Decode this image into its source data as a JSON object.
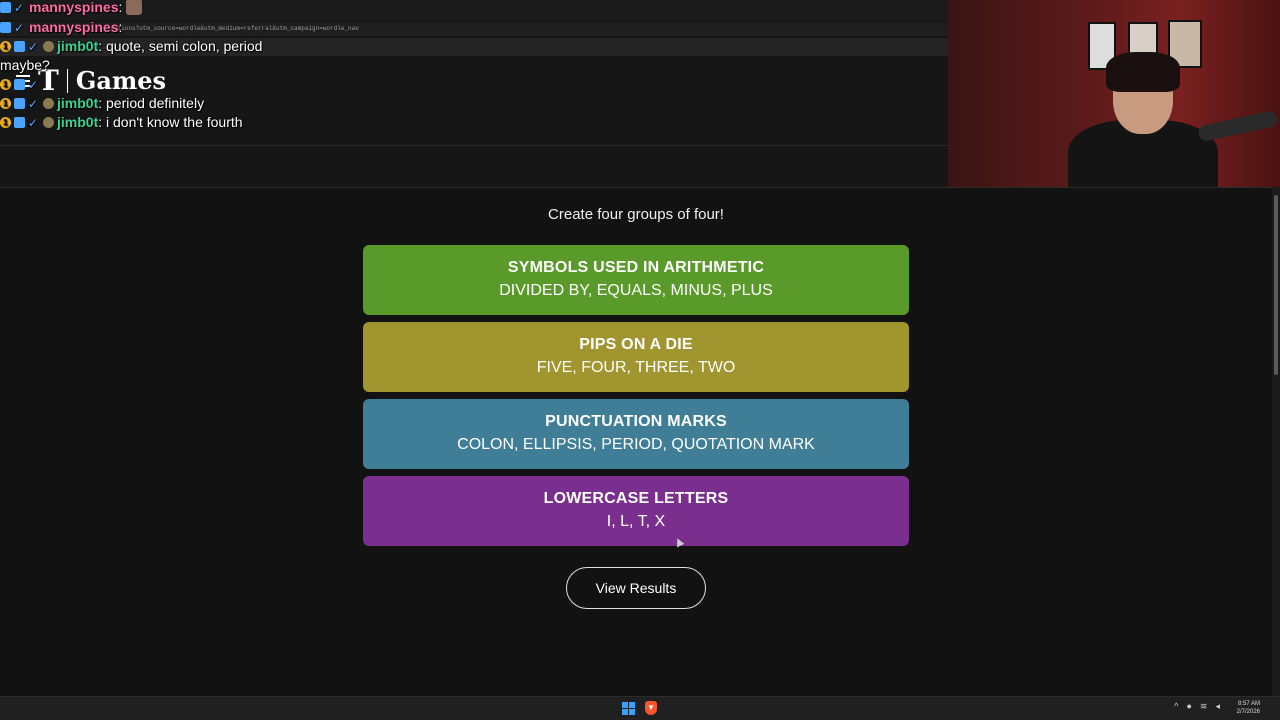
{
  "browser": {
    "url": "connections?utm_source=wordle&utm_medium=referral&utm_campaign=wordle_nav"
  },
  "site": {
    "logo_mark": "T",
    "logo_name": "Games"
  },
  "chat": [
    {
      "user": "mannyspines",
      "text": "",
      "color": "pink"
    },
    {
      "user": "mannyspines",
      "text": "",
      "color": "pink"
    },
    {
      "user": "jimb0t",
      "text": "quote, semi colon, period",
      "color": "green"
    },
    {
      "user": "",
      "text": "maybe?",
      "color": ""
    },
    {
      "user": "jimb0t",
      "text": "",
      "color": "green"
    },
    {
      "user": "jimb0t",
      "text": "period definitely",
      "color": "green"
    },
    {
      "user": "jimb0t",
      "text": "i don't know the fourth",
      "color": "green"
    }
  ],
  "game": {
    "subtitle": "Create four groups of four!",
    "groups": [
      {
        "title": "SYMBOLS USED IN ARITHMETIC",
        "words": "DIVIDED BY, EQUALS, MINUS, PLUS",
        "color": "#5a9a2a"
      },
      {
        "title": "PIPS ON A DIE",
        "words": "FIVE, FOUR, THREE, TWO",
        "color": "#a0952e"
      },
      {
        "title": "PUNCTUATION MARKS",
        "words": "COLON, ELLIPSIS, PERIOD, QUOTATION MARK",
        "color": "#3f7e96"
      },
      {
        "title": "LOWERCASE LETTERS",
        "words": "I, L, T, X",
        "color": "#7a2e8e"
      }
    ],
    "view_results_label": "View Results"
  },
  "taskbar": {
    "time": "8:57 AM",
    "date": "2/7/2026"
  }
}
